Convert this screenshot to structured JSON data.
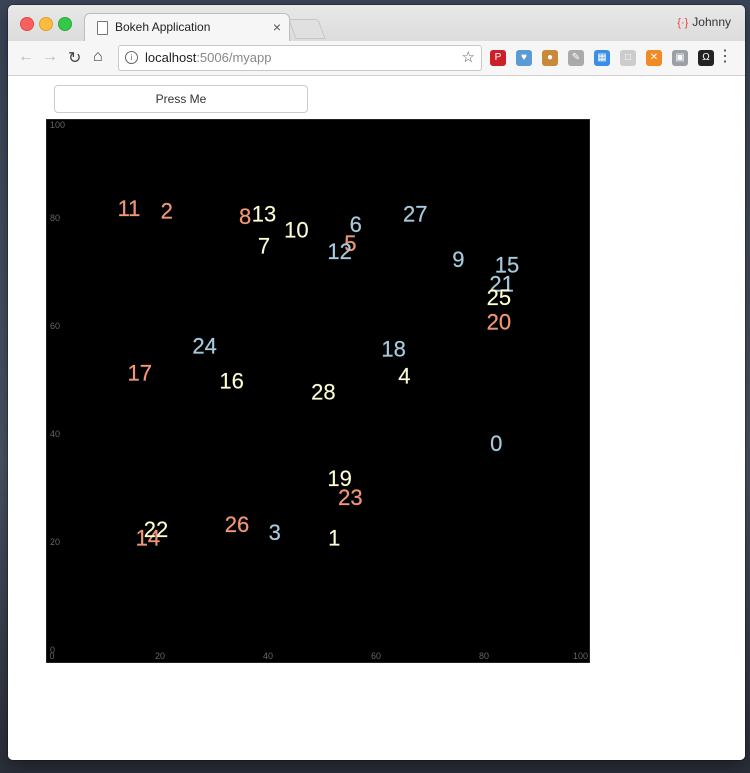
{
  "browser": {
    "tab_title": "Bokeh Application",
    "tab_close": "×",
    "profile_name": "Johnny",
    "url_host": "localhost",
    "url_rest": ":5006/myapp",
    "nav": {
      "back": "←",
      "forward": "→",
      "reload": "↻",
      "home": "⌂"
    },
    "star": "☆",
    "menu": "⋮",
    "extensions": [
      {
        "name": "pinterest-icon",
        "glyph": "P",
        "color": "#cb2027"
      },
      {
        "name": "heart-extension-icon",
        "glyph": "♥",
        "color": "#5b9bd5"
      },
      {
        "name": "cookie-icon",
        "glyph": "●",
        "color": "#c8893a"
      },
      {
        "name": "feather-icon",
        "glyph": "✎",
        "color": "#aaaaaa"
      },
      {
        "name": "windows-icon",
        "glyph": "▦",
        "color": "#3a8ee6"
      },
      {
        "name": "blank-extension-icon",
        "glyph": "□",
        "color": "#cccccc"
      },
      {
        "name": "stop-extension-icon",
        "glyph": "✕",
        "color": "#f08a24"
      },
      {
        "name": "shield-extension-icon",
        "glyph": "▣",
        "color": "#9aa0a6"
      },
      {
        "name": "omega-icon",
        "glyph": "Ω",
        "color": "#222222"
      }
    ]
  },
  "app": {
    "button_label": "Press Me"
  },
  "chart_data": {
    "type": "scatter",
    "background": "#000000",
    "xlim": [
      0,
      100
    ],
    "ylim": [
      0,
      100
    ],
    "x_ticks": [
      "0",
      "20",
      "40",
      "60",
      "80",
      "100"
    ],
    "y_ticks": [
      "0",
      "20",
      "40",
      "60",
      "80",
      "100"
    ],
    "grid": false,
    "colors": {
      "blue": "#9ecae1",
      "orange": "#fc8d62",
      "yellow": "#ffffcc"
    },
    "points": [
      {
        "text": "0",
        "x": 83,
        "y": 40,
        "color": "blue"
      },
      {
        "text": "1",
        "x": 53,
        "y": 22.5,
        "color": "yellow"
      },
      {
        "text": "2",
        "x": 22,
        "y": 83,
        "color": "orange"
      },
      {
        "text": "3",
        "x": 42,
        "y": 23.5,
        "color": "blue"
      },
      {
        "text": "4",
        "x": 66,
        "y": 52.5,
        "color": "yellow"
      },
      {
        "text": "5",
        "x": 56,
        "y": 77,
        "color": "orange"
      },
      {
        "text": "6",
        "x": 57,
        "y": 80.5,
        "color": "blue"
      },
      {
        "text": "7",
        "x": 40,
        "y": 76.5,
        "color": "yellow"
      },
      {
        "text": "8",
        "x": 36.5,
        "y": 82,
        "color": "orange"
      },
      {
        "text": "9",
        "x": 76,
        "y": 74,
        "color": "blue"
      },
      {
        "text": "10",
        "x": 46,
        "y": 79.5,
        "color": "yellow"
      },
      {
        "text": "11",
        "x": 15,
        "y": 83.5,
        "color": "orange"
      },
      {
        "text": "12",
        "x": 54,
        "y": 75.5,
        "color": "blue"
      },
      {
        "text": "13",
        "x": 40,
        "y": 82.5,
        "color": "yellow"
      },
      {
        "text": "14",
        "x": 18.5,
        "y": 22.5,
        "color": "orange"
      },
      {
        "text": "15",
        "x": 85,
        "y": 73,
        "color": "blue"
      },
      {
        "text": "16",
        "x": 34,
        "y": 51.5,
        "color": "yellow"
      },
      {
        "text": "17",
        "x": 17,
        "y": 53,
        "color": "orange"
      },
      {
        "text": "18",
        "x": 64,
        "y": 57.5,
        "color": "blue"
      },
      {
        "text": "19",
        "x": 54,
        "y": 33.5,
        "color": "yellow"
      },
      {
        "text": "20",
        "x": 83.5,
        "y": 62.5,
        "color": "orange"
      },
      {
        "text": "21",
        "x": 84,
        "y": 69.5,
        "color": "blue"
      },
      {
        "text": "22",
        "x": 20,
        "y": 24,
        "color": "yellow"
      },
      {
        "text": "23",
        "x": 56,
        "y": 30,
        "color": "orange"
      },
      {
        "text": "24",
        "x": 29,
        "y": 58,
        "color": "blue"
      },
      {
        "text": "25",
        "x": 83.5,
        "y": 67,
        "color": "yellow"
      },
      {
        "text": "26",
        "x": 35,
        "y": 25,
        "color": "orange"
      },
      {
        "text": "27",
        "x": 68,
        "y": 82.5,
        "color": "blue"
      },
      {
        "text": "28",
        "x": 51,
        "y": 49.5,
        "color": "yellow"
      }
    ]
  }
}
